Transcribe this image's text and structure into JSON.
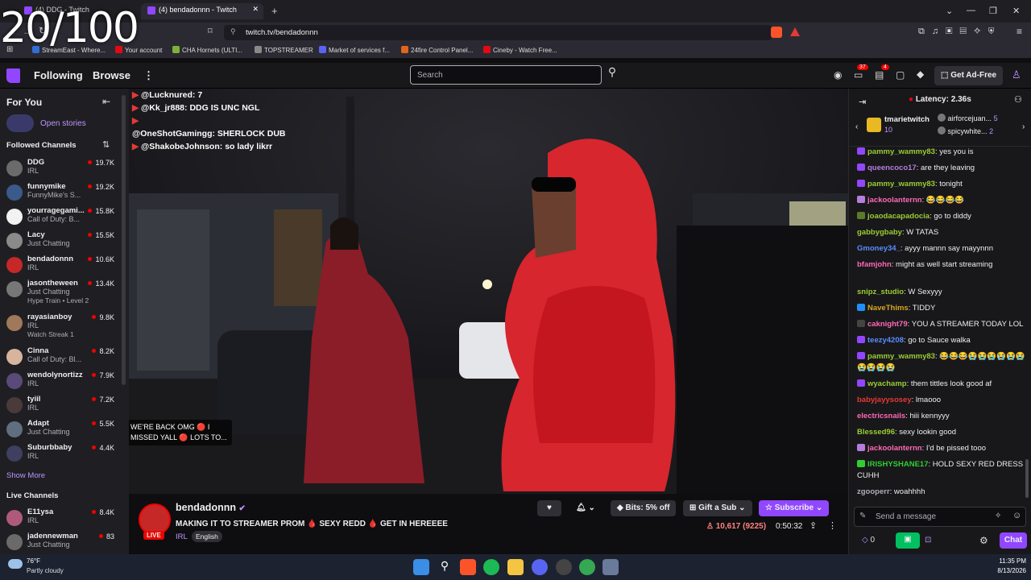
{
  "overlay_counter": "20/100",
  "browser": {
    "tabs": [
      {
        "label": "(4) DDG - Twitch"
      },
      {
        "label": "(4) bendadonnn - Twitch"
      }
    ],
    "new_tab": "+",
    "url": "twitch.tv/bendadonnn",
    "bookmarks": [
      {
        "label": "StreamEast - Where...",
        "color": "#2f6fd6"
      },
      {
        "label": "Your account",
        "color": "#e50914"
      },
      {
        "label": "CHA Hornets (ULTI...",
        "color": "#7fb03b"
      },
      {
        "label": "TOPSTREAMER",
        "color": "#888888"
      },
      {
        "label": "Market of services f...",
        "color": "#5865f2"
      },
      {
        "label": "24fire Control Panel...",
        "color": "#e0661b"
      },
      {
        "label": "Cineby - Watch Free...",
        "color": "#e50914"
      }
    ]
  },
  "twitch_nav": {
    "following": "Following",
    "browse": "Browse",
    "more": "⋮",
    "search_placeholder": "Search",
    "notif_count": "37",
    "whisper_count": "4",
    "get_ad_free": "Get Ad-Free"
  },
  "sidebar": {
    "for_you": "For You",
    "open_stories": "Open stories",
    "followed_channels": "Followed Channels",
    "channels": [
      {
        "name": "DDG",
        "category": "IRL",
        "viewers": "19.7K",
        "color": "#6b6b6b"
      },
      {
        "name": "funnymike",
        "category": "FunnyMike's S...",
        "viewers": "19.2K",
        "color": "#3a5a8a"
      },
      {
        "name": "yourragegami...",
        "category": "Call of Duty: B...",
        "viewers": "15.8K",
        "color": "#f2f2f2"
      },
      {
        "name": "Lacy",
        "category": "Just Chatting",
        "viewers": "15.5K",
        "color": "#8a8a8a"
      },
      {
        "name": "bendadonnn",
        "category": "IRL",
        "viewers": "10.6K",
        "color": "#c62828"
      },
      {
        "name": "jasontheween",
        "category": "Just Chatting",
        "viewers": "13.4K",
        "extra": "Hype Train • Level 2",
        "color": "#777777"
      },
      {
        "name": "rayasianboy",
        "category": "IRL",
        "viewers": "9.8K",
        "extra": "Watch Streak 1",
        "color": "#a0785a"
      },
      {
        "name": "Cinna",
        "category": "Call of Duty: Bl...",
        "viewers": "8.2K",
        "color": "#d7b49e"
      },
      {
        "name": "wendolynortizz",
        "category": "IRL",
        "viewers": "7.9K",
        "color": "#5a4a7a"
      },
      {
        "name": "tyiil",
        "category": "IRL",
        "viewers": "7.2K",
        "color": "#4a3a3a"
      },
      {
        "name": "Adapt",
        "category": "Just Chatting",
        "viewers": "5.5K",
        "color": "#5f6f7f"
      },
      {
        "name": "Suburbbaby",
        "category": "IRL",
        "viewers": "4.4K",
        "color": "#3f3f5f"
      }
    ],
    "show_more": "Show More",
    "live_channels": "Live Channels",
    "live": [
      {
        "name": "E11ysa",
        "category": "IRL",
        "viewers": "8.4K",
        "color": "#b05a7a"
      },
      {
        "name": "jadennewman",
        "category": "Just Chatting",
        "viewers": "83",
        "color": "#6a6a6a"
      }
    ]
  },
  "video_overlay": {
    "top_chat": [
      {
        "user": "@Lucknured",
        "text": "7"
      },
      {
        "user": "@Kk_jr888",
        "text": "DDG IS UNC NGL"
      },
      {
        "user": "@OneShotGamingg",
        "text": "SHERLOCK DUB"
      },
      {
        "user": "@ShakobeJohnson",
        "text": "so lady likrr"
      }
    ],
    "caption": "WE'RE BACK OMG 🔴 I MISSED YALL 🔴 LOTS TO..."
  },
  "stream_info": {
    "channel": "bendadonnn",
    "live_badge": "LIVE",
    "title": "MAKING IT TO STREAMER PROM 🩸 SEXY REDD 🩸 GET IN HEREEEE",
    "category": "IRL",
    "tag": "English",
    "viewers": "10,617",
    "viewers_sub": "(9225)",
    "uptime": "0:50:32",
    "bits": "Bits: 5% off",
    "gift": "Gift a Sub",
    "subscribe": "Subscribe"
  },
  "chat": {
    "latency": "Latency: 2.36s",
    "gifter": "tmarietwitch",
    "gifter_count": "10",
    "top_gifters": [
      {
        "name": "airforcejuan...",
        "count": "5"
      },
      {
        "name": "spicywhite...",
        "count": "2"
      }
    ],
    "messages": [
      {
        "user": "pammy_wammy83",
        "text": "yes you is",
        "color": "#9acd32",
        "badge": "#9147ff"
      },
      {
        "user": "queencoco17",
        "text": "are they leaving",
        "color": "#b57edc",
        "badge": "#9147ff"
      },
      {
        "user": "pammy_wammy83",
        "text": "tonight",
        "color": "#9acd32",
        "badge": "#9147ff"
      },
      {
        "user": "jackoolanternn",
        "text": "😂😂😂😂",
        "color": "#ff69b4",
        "badge": "#b57edc"
      },
      {
        "user": "joaodacapadocia",
        "text": "go to diddy",
        "color": "#9acd32",
        "badge": "#5c7a2c"
      },
      {
        "user": "gabbygbaby",
        "text": "W TATAS",
        "color": "#9acd32",
        "badge": ""
      },
      {
        "user": "Gmoney34_",
        "text": "ayyy mannn say mayynnn",
        "color": "#5b8cff",
        "badge": ""
      },
      {
        "user": "bfamjohn",
        "text": "might as well start streaming",
        "color": "#ff69b4",
        "badge": ""
      },
      {
        "user": "snipz_studio",
        "text": "W Sexyyy",
        "color": "#9acd32",
        "badge": ""
      },
      {
        "user": "NaveThims",
        "text": "TIDDY",
        "color": "#daa520",
        "badge": "#1e90ff"
      },
      {
        "user": "caknight79",
        "text": "YOU A STREAMER TODAY LOL",
        "color": "#ff69b4",
        "badge": "#444444"
      },
      {
        "user": "teezy4208",
        "text": "go to Sauce walka",
        "color": "#5b8cff",
        "badge": "#9147ff"
      },
      {
        "user": "pammy_wammy83",
        "text": "😂😂😂😭😭😭😭😭😭😭😭😭😭",
        "color": "#9acd32",
        "badge": "#9147ff"
      },
      {
        "user": "wyachamp",
        "text": "them tittles look good af",
        "color": "#9acd32",
        "badge": "#9147ff"
      },
      {
        "user": "babyjayysosey",
        "text": "lmaooo",
        "color": "#e53935",
        "badge": ""
      },
      {
        "user": "electricsnails",
        "text": "hiii kennyyy",
        "color": "#ff69b4",
        "badge": ""
      },
      {
        "user": "Blessed96",
        "text": "sexy lookin good",
        "color": "#9acd32",
        "badge": ""
      },
      {
        "user": "jackoolanternn",
        "text": "I'd be pissed tooo",
        "color": "#ff69b4",
        "badge": "#b57edc"
      },
      {
        "user": "IRISHYSHANE17",
        "text": "HOLD SEXY RED DRESS CUHH",
        "color": "#32cd32",
        "badge": "#32cd32"
      },
      {
        "user": "zgooperr",
        "text": "woahhhh",
        "color": "#adadb8",
        "badge": ""
      }
    ],
    "input_placeholder": "Send a message",
    "points": "0",
    "chat_button": "Chat"
  },
  "taskbar": {
    "temp": "76°F",
    "weather": "Partly cloudy",
    "time": "11:35 PM",
    "date": "8/13/2026"
  }
}
